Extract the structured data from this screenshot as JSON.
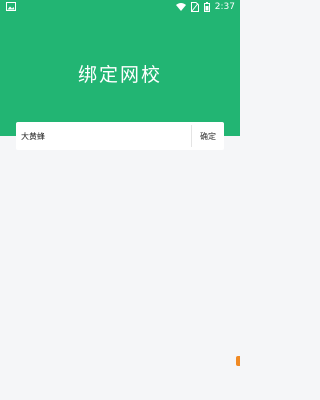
{
  "status_bar": {
    "time": "2:37",
    "icons": [
      "image-notification-icon",
      "wifi-icon",
      "no-sim-icon",
      "battery-icon"
    ]
  },
  "header": {
    "title": "绑定网校",
    "background_color": "#22b573"
  },
  "form": {
    "school_input_value": "大黄蜂",
    "confirm_label": "确定"
  },
  "colors": {
    "accent": "#22b573",
    "page_background": "#f5f6f8",
    "edge_mark": "#f08a24"
  }
}
